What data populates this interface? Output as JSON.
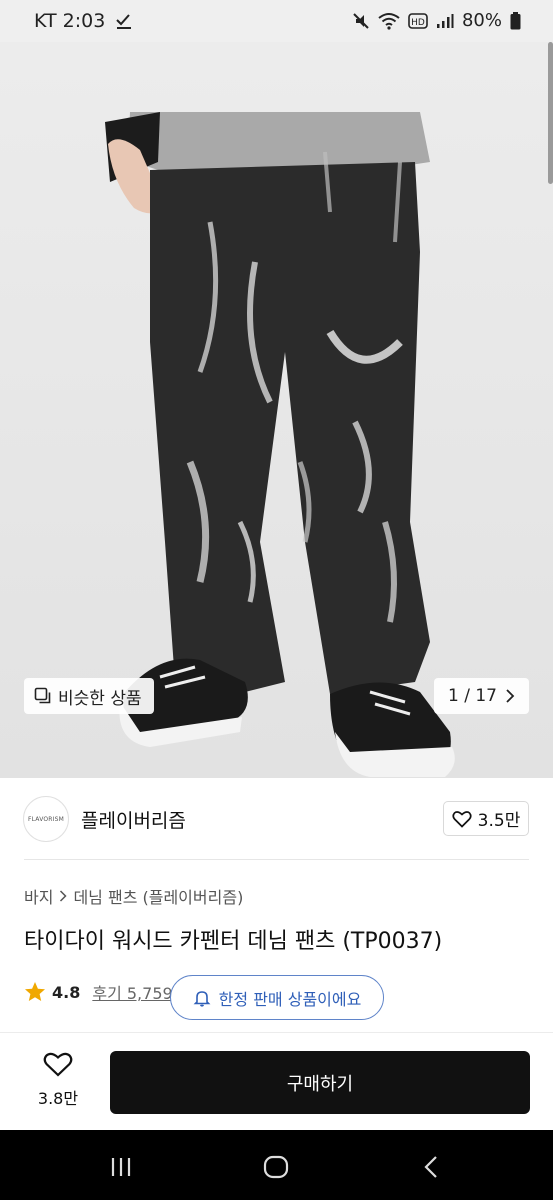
{
  "status_bar": {
    "carrier_time": "KT 2:03",
    "battery": "80%",
    "icons": [
      "download-check-icon",
      "mute-icon",
      "wifi-icon",
      "hd-icon",
      "signal-icon",
      "battery-icon"
    ]
  },
  "gallery": {
    "similar_label": "비슷한 상품",
    "page_indicator": "1 / 17"
  },
  "brand": {
    "logo_text": "FLAVORISM",
    "name": "플레이버리즘",
    "like_count": "3.5만"
  },
  "breadcrumb": {
    "category": "바지",
    "subcategory": "데님 팬츠 (플레이버리즘)"
  },
  "product": {
    "title": "타이다이 워시드 카펜터 데님 팬츠 (TP0037)",
    "rating": "4.8",
    "reviews": "후기 5,759"
  },
  "notice": {
    "limited_label": "한정 판매 상품이에요"
  },
  "buy_bar": {
    "wish_count": "3.8만",
    "buy_label": "구매하기"
  },
  "colors": {
    "accent_blue": "#2f5fb8",
    "star": "#f0a800",
    "buy_button": "#111111"
  }
}
